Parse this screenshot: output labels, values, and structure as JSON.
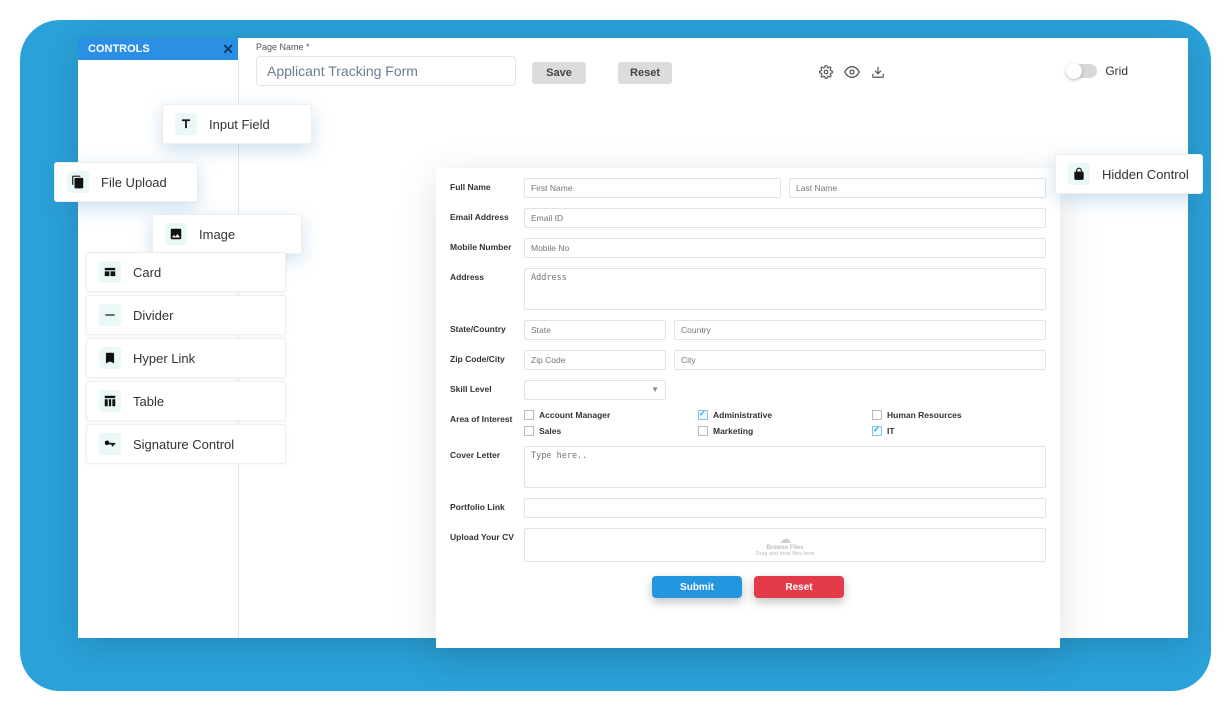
{
  "controls_panel": {
    "title": "CONTROLS"
  },
  "topbar": {
    "page_name_label": "Page Name *",
    "page_name_value": "Applicant Tracking Form",
    "save_label": "Save",
    "reset_label": "Reset",
    "grid_label": "Grid"
  },
  "chips": {
    "input_field": "Input Field",
    "file_upload": "File Upload",
    "image": "Image",
    "card": "Card",
    "divider": "Divider",
    "hyperlink": "Hyper Link",
    "table": "Table",
    "signature": "Signature Control",
    "hidden": "Hidden Control"
  },
  "form": {
    "labels": {
      "full_name": "Full Name",
      "email": "Email Address",
      "mobile": "Mobile Number",
      "address": "Address",
      "state_country": "State/Country",
      "zip_city": "Zip Code/City",
      "skill": "Skill Level",
      "interest": "Area of Interest",
      "cover": "Cover Letter",
      "portfolio": "Portfolio Link",
      "upload_cv": "Upload Your CV"
    },
    "placeholders": {
      "first_name": "First Name",
      "last_name": "Last Name",
      "email": "Email ID",
      "mobile": "Mobile No",
      "address": "Address",
      "state": "State",
      "country": "Country",
      "zip": "Zip Code",
      "city": "City",
      "cover": "Type here..",
      "browse": "Browse Files",
      "drag": "Drag and drop files here"
    },
    "interests": [
      {
        "label": "Account Manager",
        "checked": false
      },
      {
        "label": "Administrative",
        "checked": true
      },
      {
        "label": "Human Resources",
        "checked": false
      },
      {
        "label": "Sales",
        "checked": false
      },
      {
        "label": "Marketing",
        "checked": false
      },
      {
        "label": "IT",
        "checked": true
      }
    ],
    "buttons": {
      "submit": "Submit",
      "reset": "Reset"
    }
  }
}
